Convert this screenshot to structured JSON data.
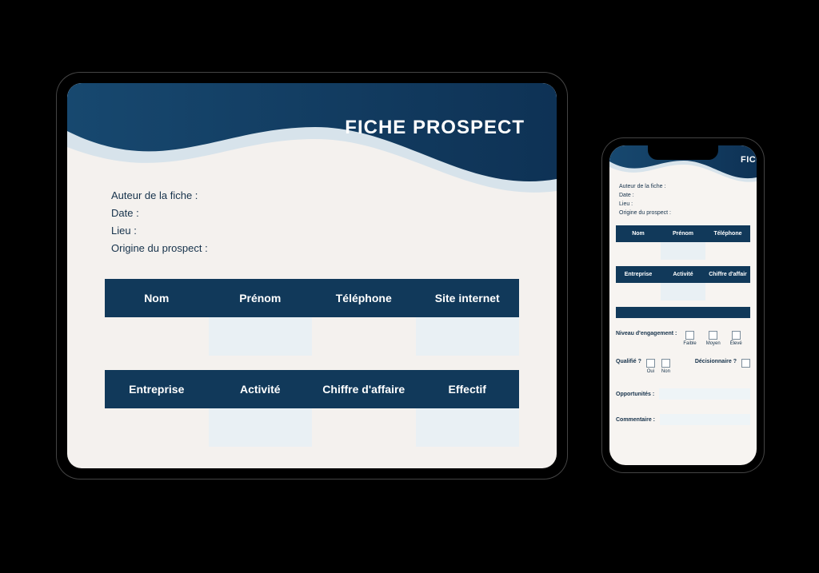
{
  "form": {
    "title": "FICHE PROSPECT",
    "title_truncated": "FIC",
    "meta": {
      "author": "Auteur de la fiche :",
      "date": "Date :",
      "lieu": "Lieu :",
      "origine": "Origine du prospect :"
    },
    "row1": [
      "Nom",
      "Prénom",
      "Téléphone",
      "Site internet"
    ],
    "row1_phone": [
      "Nom",
      "Prénom",
      "Téléphone"
    ],
    "row2": [
      "Entreprise",
      "Activité",
      "Chiffre d'affaire",
      "Effectif"
    ],
    "row2_phone": [
      "Entreprise",
      "Activité",
      "Chiffre d'affair"
    ],
    "engagement": {
      "label": "Niveau d'engagement :",
      "options": [
        "Faible",
        "Moyen",
        "Élevé"
      ]
    },
    "qualifie": {
      "label": "Qualifié ?",
      "options": [
        "Oui",
        "Non"
      ]
    },
    "decisionnaire": {
      "label": "Décisionnaire ?"
    },
    "opportunites": "Opportunités :",
    "commentaire": "Commentaire :"
  },
  "colors": {
    "primary": "#11395a",
    "body": "#f4f1ee"
  }
}
